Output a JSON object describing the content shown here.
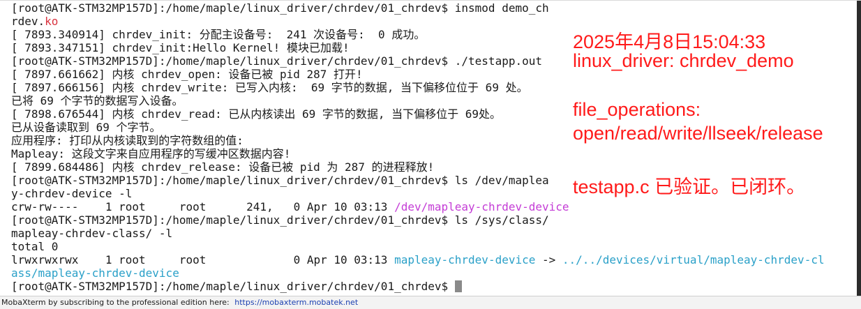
{
  "terminal": {
    "lines": [
      {
        "text": "[root@ATK-STM32MP157D]:/home/maple/linux_driver/chrdev/01_chrdev$ insmod demo_ch"
      },
      {
        "text": "rdev.",
        "suffix": "ko"
      },
      {
        "text": "[ 7893.340914] chrdev_init: 分配主设备号:  241 次设备号:  0 成功。"
      },
      {
        "text": "[ 7893.347151] chrdev_init:Hello Kernel! 模块已加载!"
      },
      {
        "text": "[root@ATK-STM32MP157D]:/home/maple/linux_driver/chrdev/01_chrdev$ ./testapp.out"
      },
      {
        "text": "[ 7897.661662] 内核 chrdev_open: 设备已被 pid 287 打开!"
      },
      {
        "text": "[ 7897.666156] 内核 chrdev_write: 已写入内核:  69 字节的数据, 当下偏移位位于 69 处。"
      },
      {
        "text": "已将 69 个字节的数据写入设备。"
      },
      {
        "text": "[ 7898.676544] 内核 chrdev_read: 已从内核读出 69 字节的数据, 当下偏移位于 69处。"
      },
      {
        "text": "已从设备读取到 69 个字节。"
      },
      {
        "text": "应用程序: 打印从内核读取到的字符数组的值:"
      },
      {
        "text": "Mapleay: 这段文字来自应用程序的写缓冲区数据内容!"
      },
      {
        "text": "[ 7899.684486] 内核 chrdev_release: 设备已被 pid 为 287 的进程释放!"
      },
      {
        "text": "[root@ATK-STM32MP157D]:/home/maple/linux_driver/chrdev/01_chrdev$ ls /dev/maplea"
      },
      {
        "text": "y-chrdev-device -l"
      },
      {
        "text": "crw-rw----    1 root     root      241,   0 Apr 10 03:13 ",
        "magenta": "/dev/mapleay-chrdev-device"
      },
      {
        "text": "[root@ATK-STM32MP157D]:/home/maple/linux_driver/chrdev/01_chrdev$ ls /sys/class/"
      },
      {
        "text": "mapleay-chrdev-class/ -l"
      },
      {
        "text": "total 0"
      },
      {
        "text": "lrwxrwxrwx    1 root     root             0 Apr 10 03:13 ",
        "cyan": "mapleay-chrdev-device",
        "mid": " -> ",
        "cyan2": "../../devices/virtual/mapleay-chrdev-cl"
      },
      {
        "cyan": "ass/mapleay-chrdev-device"
      },
      {
        "text": "[root@ATK-STM32MP157D]:/home/maple/linux_driver/chrdev/01_chrdev$ ",
        "cursor": true
      }
    ]
  },
  "annotations": {
    "line1": "2025年4月8日15:04:33",
    "line2": "linux_driver: chrdev_demo",
    "line3": "file_operations:",
    "line4": "open/read/write/llseek/release",
    "line5": "testapp.c 已验证。已闭环。"
  },
  "footer": {
    "text": "MobaXterm by subscribing to the professional edition here:",
    "link": "https://mobaxterm.mobatek.net"
  },
  "colors": {
    "annotation": "#ff1a1a",
    "magenta": "#c43cd6",
    "cyan": "#2aa0c8",
    "ko": "#d9333f"
  }
}
